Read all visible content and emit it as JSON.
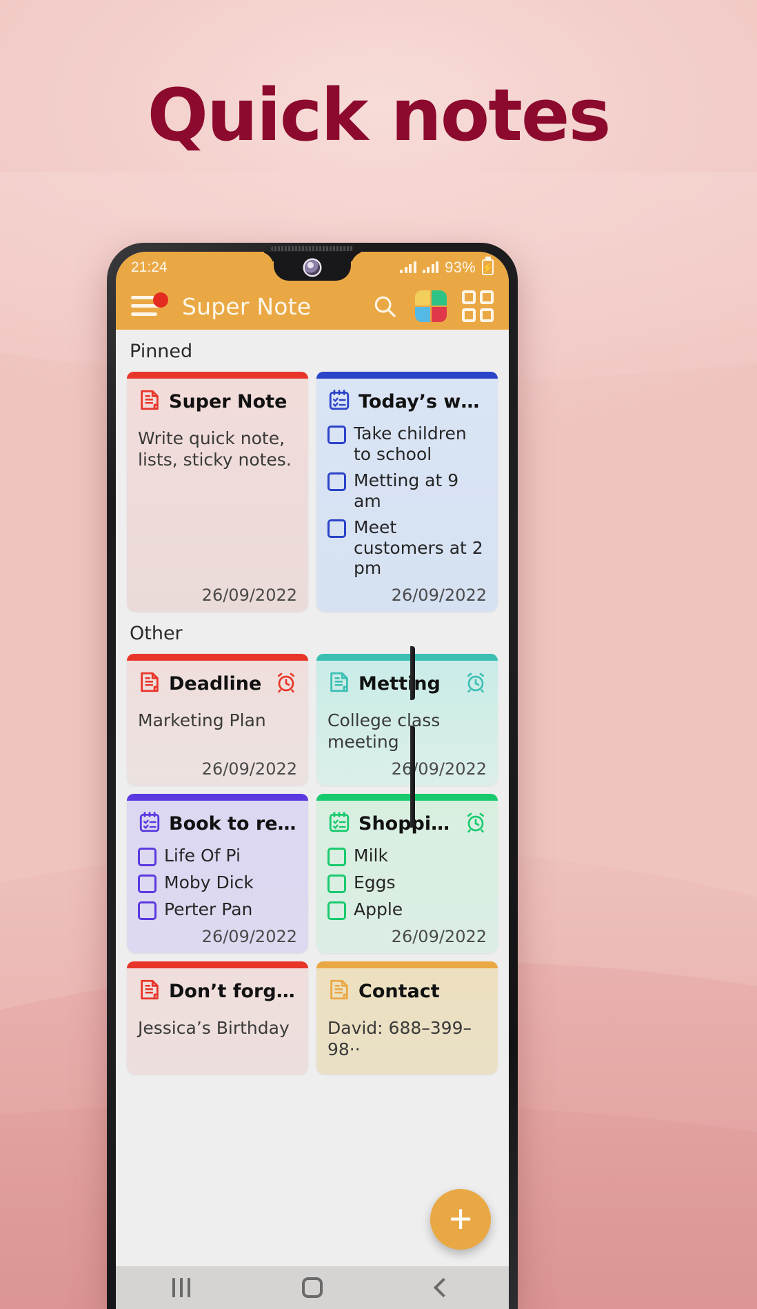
{
  "promo": {
    "headline": "Quick notes"
  },
  "phone": {
    "status_bar": {
      "time": "21:24",
      "battery_percent": "93%",
      "battery_charging": true,
      "signal_groups": 2
    },
    "app_bar": {
      "title": "Super Note",
      "menu_badge": true,
      "icons": [
        "search-icon",
        "theme-palette-icon",
        "grid-view-icon"
      ]
    },
    "sections": [
      {
        "label": "Pinned",
        "cards": [
          {
            "title": "Super Note",
            "icon": "note-icon",
            "kind": "note",
            "text": "Write quick note, lists, sticky notes.",
            "date": "26/09/2022",
            "alarm": false,
            "accent": "#e8352a",
            "bg_top": "#f2dcda",
            "bg_bottom": "#eadbd9"
          },
          {
            "title": "Today’s wor···",
            "icon": "checklist-icon",
            "kind": "checklist",
            "items": [
              "Take children to school",
              "Metting at 9 am",
              "Meet customers at 2 pm"
            ],
            "date": "26/09/2022",
            "alarm": false,
            "accent": "#2a43c8",
            "bg_top": "#d9e4f5",
            "bg_bottom": "#d6e1f2"
          }
        ]
      },
      {
        "label": "Other",
        "cards": [
          {
            "title": "Deadline",
            "icon": "note-icon",
            "kind": "note",
            "text": "Marketing Plan",
            "date": "26/09/2022",
            "alarm": true,
            "accent": "#e8352a",
            "bg_top": "#f0dedc",
            "bg_bottom": "#ebe2e0"
          },
          {
            "title": "Metting",
            "icon": "note-icon",
            "kind": "note",
            "text": "College class meeting",
            "date": "26/09/2022",
            "alarm": true,
            "accent": "#3cbfb3",
            "bg_top": "#c8ece8",
            "bg_bottom": "#dceee9"
          },
          {
            "title": "Book to reads",
            "icon": "checklist-icon",
            "kind": "checklist",
            "items": [
              "Life Of Pi",
              "Moby Dick",
              "Perter Pan"
            ],
            "date": "26/09/2022",
            "alarm": false,
            "accent": "#5b38e0",
            "bg_top": "#dcd8f2",
            "bg_bottom": "#ddd9f0"
          },
          {
            "title": "Shopping list",
            "icon": "checklist-icon",
            "kind": "checklist",
            "items": [
              "Milk",
              "Eggs",
              "Apple"
            ],
            "date": "26/09/2022",
            "alarm": true,
            "accent": "#18ca6e",
            "bg_top": "#d8efe0",
            "bg_bottom": "#dceee4"
          },
          {
            "title": "Don’t forget",
            "icon": "note-icon",
            "kind": "note",
            "text": "Jessica’s Birthday",
            "date": "",
            "alarm": false,
            "accent": "#e8352a",
            "bg_top": "#f0dedc",
            "bg_bottom": "#ecdedd"
          },
          {
            "title": "Contact",
            "icon": "note-icon",
            "kind": "note",
            "text": "David: 688–399–98··",
            "date": "",
            "alarm": false,
            "accent": "#eaa844",
            "bg_top": "#ece0bf",
            "bg_bottom": "#eae0c6"
          }
        ]
      }
    ],
    "fab": {
      "label": "+"
    },
    "nav_bar": {
      "items": [
        "recents-button",
        "home-button",
        "back-button"
      ]
    }
  }
}
